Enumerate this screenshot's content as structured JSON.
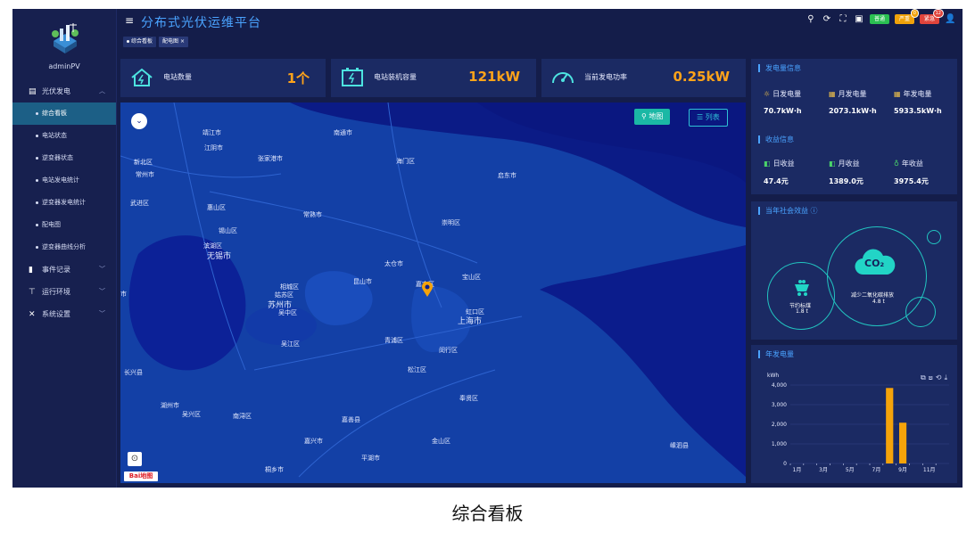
{
  "sidebar": {
    "username": "adminPV",
    "nav": [
      {
        "label": "光伏发电",
        "icon": "chart-icon",
        "expanded": true
      },
      {
        "label": "事件记录",
        "icon": "book-icon"
      },
      {
        "label": "运行环境",
        "icon": "tool-icon"
      },
      {
        "label": "系统设置",
        "icon": "wrench-icon"
      }
    ],
    "subitems": [
      "综合看板",
      "电站状态",
      "逆变器状态",
      "电站发电统计",
      "逆变器发电统计",
      "配电图",
      "逆变器曲线分析"
    ]
  },
  "header": {
    "title": "分布式光伏运维平台",
    "buttons": [
      "普通",
      "严重",
      "紧急"
    ],
    "severe_count": "0",
    "urgent_count": "12",
    "tabs": [
      "综合看板",
      "配电图"
    ],
    "close_glyph": "×"
  },
  "stats": [
    {
      "label": "电站数量",
      "value": "1个",
      "icon": "home-icon"
    },
    {
      "label": "电站装机容量",
      "value": "121kW",
      "icon": "battery-icon"
    },
    {
      "label": "当前发电功率",
      "value": "0.25kW",
      "icon": "gauge-icon"
    }
  ],
  "map": {
    "btn_map": "地图",
    "btn_list": "列表",
    "logo_text": "Bai地图",
    "labels": [
      "靖江市",
      "南通市",
      "江阴市",
      "新北区",
      "张家港市",
      "海门区",
      "常州市",
      "启东市",
      "武进区",
      "惠山区",
      "常熟市",
      "崇明区",
      "锡山区",
      "滨湖区",
      "无锡市",
      "太仓市",
      "相城区",
      "姑苏区",
      "苏州市",
      "吴中区",
      "昆山市",
      "嘉定区",
      "宝山区",
      "虹口区",
      "上海市",
      "青浦区",
      "吴江区",
      "闵行区",
      "松江区",
      "长兴县",
      "奉贤区",
      "湖州市",
      "吴兴区",
      "南浔区",
      "嘉善县",
      "嘉兴市",
      "金山区",
      "平湖市",
      "嵊泗县",
      "桐乡市",
      "市"
    ]
  },
  "generation": {
    "title": "发电量信息",
    "items": [
      {
        "label": "日发电量",
        "value": "70.7kW·h"
      },
      {
        "label": "月发电量",
        "value": "2073.1kW·h"
      },
      {
        "label": "年发电量",
        "value": "5933.5kW·h"
      }
    ]
  },
  "revenue": {
    "title": "收益信息",
    "items": [
      {
        "label": "日收益",
        "value": "47.4元"
      },
      {
        "label": "月收益",
        "value": "1389.0元"
      },
      {
        "label": "年收益",
        "value": "3975.4元"
      }
    ]
  },
  "social": {
    "title": "当年社会效益",
    "co2_label": "CO₂",
    "co2_text": "减少二氧化碳排放",
    "co2_value": "4.8 t",
    "coal_text": "节约标煤",
    "coal_value": "1.8 t"
  },
  "chart_data": {
    "type": "bar",
    "title": "年发电量",
    "ylabel": "kWh",
    "ylim": [
      0,
      4000
    ],
    "yticks": [
      "0",
      "1,000",
      "2,000",
      "3,000",
      "4,000"
    ],
    "categories": [
      "1月",
      "2月",
      "3月",
      "4月",
      "5月",
      "6月",
      "7月",
      "8月",
      "9月",
      "10月",
      "11月",
      "12月"
    ],
    "xtick_labels": [
      "1月",
      "3月",
      "5月",
      "7月",
      "9月",
      "11月"
    ],
    "values": [
      0,
      0,
      0,
      0,
      0,
      0,
      0,
      3850,
      2080,
      0,
      0,
      0
    ],
    "bar_color": "#f5a30a"
  },
  "caption": "综合看板"
}
